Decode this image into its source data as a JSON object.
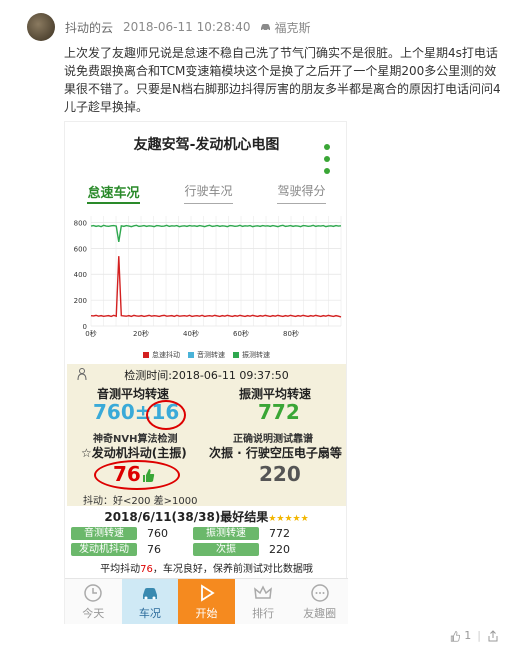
{
  "post": {
    "author": "抖动的云",
    "time": "2018-06-11 10:28:40",
    "location": "福克斯",
    "text": "上次发了友趣师兄说是怠速不稳自己洗了节气门确实不是很脏。上个星期4s打电话说免费跟换离合和TCM变速箱模块这个是换了之后开了一个星期200多公里测的效果很不错了。只要是N档右脚那边抖得厉害的朋友多半都是离合的原因打电话问问4儿子趁早换掉。",
    "like_count": "1",
    "like_icon": "thumb-up-icon",
    "share_icon": "share-icon"
  },
  "app": {
    "title": "友趣安驾-发动机心电图",
    "tabs": [
      "怠速车况",
      "行驶车况",
      "驾驶得分"
    ],
    "active_tab": 0
  },
  "chart_data": {
    "type": "line",
    "x_ticks": [
      "0秒",
      "20秒",
      "40秒",
      "60秒",
      "80秒"
    ],
    "y_ticks": [
      "0",
      "200",
      "400",
      "600",
      "800"
    ],
    "ylim": [
      0,
      850
    ],
    "xlim": [
      0,
      100
    ],
    "legend": [
      "怠速抖动",
      "音测转速",
      "振测转速"
    ],
    "colors": [
      "#d32020",
      "#4ab3d8",
      "#2fa84f"
    ],
    "series": [
      {
        "name": "怠速抖动",
        "values": [
          80,
          78,
          82,
          76,
          80,
          75,
          78,
          80,
          74,
          82,
          76,
          540,
          80,
          78,
          76,
          80,
          74,
          82,
          78,
          76,
          80,
          74,
          78,
          82,
          76,
          80,
          78,
          74,
          80,
          82,
          76,
          78,
          80,
          74,
          82,
          76,
          78,
          80,
          76,
          82,
          74,
          78,
          80,
          76,
          82,
          74,
          78,
          80,
          76,
          82,
          78,
          74,
          80,
          76,
          82,
          78,
          74,
          80,
          76,
          82,
          78,
          74,
          80,
          76,
          82,
          78,
          74,
          80,
          76,
          82,
          78,
          74,
          80,
          76,
          82,
          78,
          74,
          80,
          76,
          82,
          78,
          74,
          80,
          76,
          82,
          78,
          74,
          80,
          76,
          82,
          78,
          74,
          80,
          76,
          82,
          78,
          74,
          80,
          76,
          70
        ]
      },
      {
        "name": "振测转速",
        "values": [
          772,
          776,
          770,
          774,
          768,
          778,
          772,
          770,
          774,
          776,
          772,
          650,
          774,
          770,
          776,
          772,
          768,
          774,
          778,
          770,
          772,
          776,
          770,
          774,
          772,
          768,
          776,
          774,
          770,
          772,
          778,
          770,
          774,
          772,
          776,
          768,
          772,
          774,
          770,
          776,
          772,
          774,
          770,
          776,
          772,
          768,
          774,
          778,
          770,
          772,
          776,
          770,
          774,
          772,
          768,
          776,
          774,
          770,
          772,
          778,
          770,
          774,
          772,
          776,
          768,
          772,
          774,
          770,
          776,
          772,
          774,
          770,
          776,
          772,
          768,
          774,
          778,
          770,
          772,
          776,
          770,
          774,
          772,
          768,
          776,
          774,
          770,
          772,
          778,
          770,
          774,
          772,
          776,
          768,
          772,
          774,
          770,
          776,
          772,
          774
        ]
      }
    ]
  },
  "stats": {
    "time_label": "检测时间:2018-06-11 09:37:50",
    "sound_avg_label": "音测平均转速",
    "sound_avg": "760",
    "sound_err": "±16",
    "vib_avg_label": "振测平均转速",
    "vib_avg": "772",
    "sound_note": "神奇NVH算法检测",
    "vib_note": "正确说明测试靠谱",
    "shake_label": "☆发动机抖动(主振)",
    "shake_value": "76",
    "sub_label": "次振 · 行驶空压电子扇等",
    "sub_value": "220",
    "shake_hint": "抖动：好<200 差>1000"
  },
  "best": {
    "title": "2018/6/11(38/38)最好结果",
    "stars": "★★★★★",
    "rows": [
      {
        "k1": "音测转速",
        "v1": "760",
        "k2": "振测转速",
        "v2": "772"
      },
      {
        "k1": "发动机抖动",
        "v1": "76",
        "k2": "次振",
        "v2": "220"
      }
    ],
    "summary_a": "平均抖动",
    "summary_b": "76",
    "summary_c": "，车况良好，保养前测试对比数据哦"
  },
  "nav": [
    "今天",
    "车况",
    "开始",
    "排行",
    "友趣圈"
  ]
}
